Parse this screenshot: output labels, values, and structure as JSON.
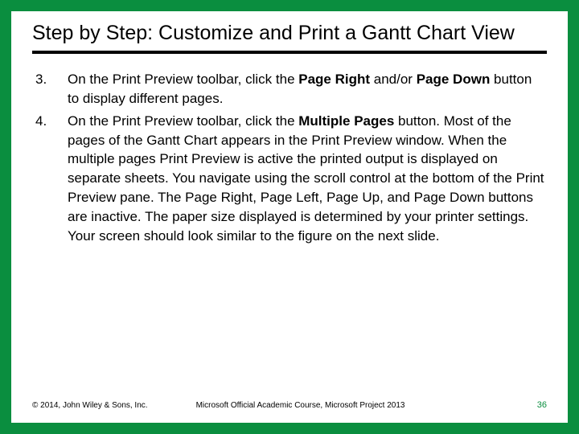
{
  "title": "Step by Step: Customize and Print a Gantt Chart View",
  "steps": {
    "s3": {
      "pre": "On the Print Preview toolbar, click the ",
      "b1": "Page Right",
      "mid": " and/or ",
      "b2": "Page Down",
      "post": " button to display different pages."
    },
    "s4": {
      "pre": "On the Print Preview toolbar, click the ",
      "b1": "Multiple Pages",
      "post": " button. Most of the pages of the Gantt Chart appears in the Print Preview window. When the multiple pages Print Preview is active the printed output is displayed on separate sheets. You navigate using the scroll control at the bottom of the Print Preview pane. The Page Right, Page Left, Page Up, and Page Down buttons are inactive. The paper size displayed is determined by your printer settings. Your screen should look similar to the figure on the next slide."
    }
  },
  "footer": {
    "copyright": "© 2014, John Wiley & Sons, Inc.",
    "course": "Microsoft Official Academic Course, Microsoft Project 2013",
    "page": "36"
  }
}
